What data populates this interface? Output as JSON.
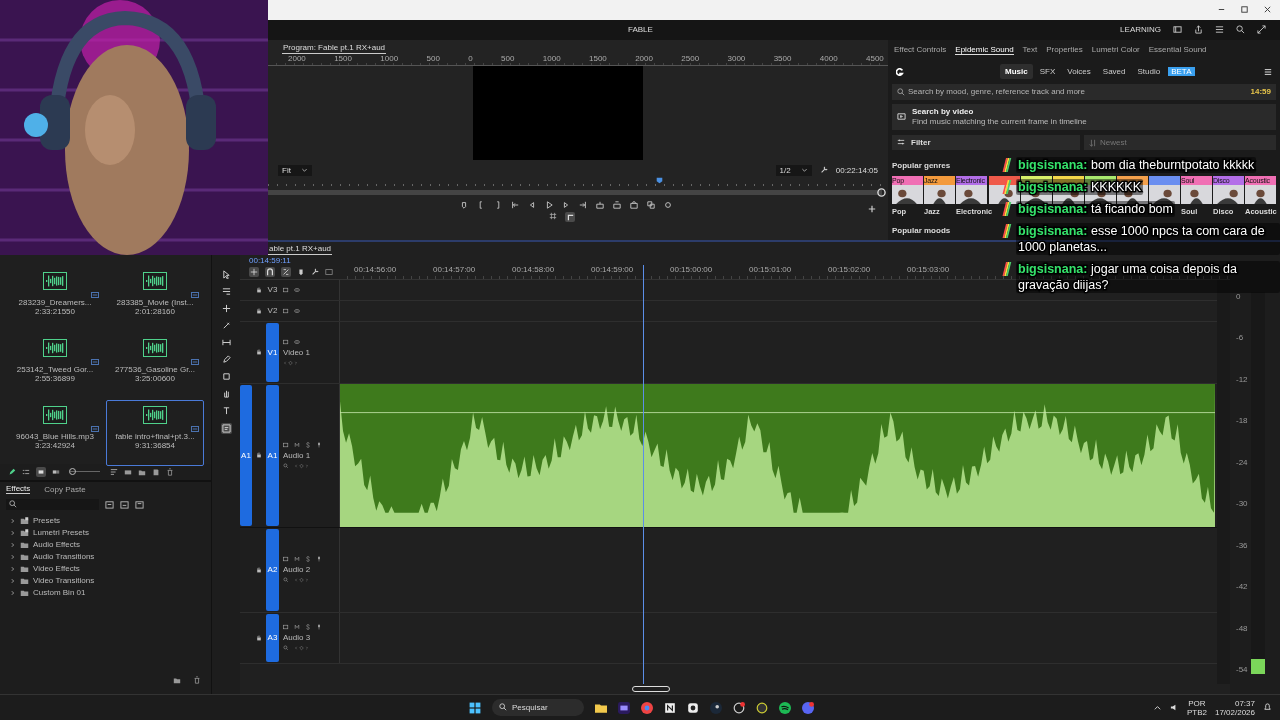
{
  "titlebar": {
    "app_title": "FABLE",
    "workspace": "LEARNING"
  },
  "program_monitor": {
    "tab": "Program: Fable pt.1 RX+aud",
    "ruler": [
      "2000",
      "1500",
      "1000",
      "500",
      "0",
      "500",
      "1000",
      "1500",
      "2000",
      "2500",
      "3000",
      "3500",
      "4000",
      "4500"
    ],
    "zoom": "Fit",
    "resolution": "1/2",
    "timecode": "00:22:14:05",
    "playhead": {
      "level": 0.63
    }
  },
  "panel": {
    "tabs": [
      {
        "label": "Effect Controls",
        "selected": false
      },
      {
        "label": "Epidemic Sound",
        "selected": true
      },
      {
        "label": "Text",
        "selected": false
      },
      {
        "label": "Properties",
        "selected": false
      },
      {
        "label": "Lumetri Color",
        "selected": false
      },
      {
        "label": "Essential Sound",
        "selected": false
      }
    ],
    "nav": [
      {
        "label": "Music",
        "selected": true
      },
      {
        "label": "SFX",
        "selected": false
      },
      {
        "label": "Voices",
        "selected": false
      },
      {
        "label": "Saved",
        "selected": false
      },
      {
        "label": "Studio",
        "selected": false,
        "badge": "BETA"
      }
    ],
    "search": {
      "placeholder": "Search by mood, genre, reference track and more"
    },
    "timer": "14:59",
    "video_search": {
      "title": "Search by video",
      "subtitle": "Find music matching the current frame in timeline"
    },
    "filter": "Filter",
    "sort": {
      "placeholder": "Newest"
    },
    "genres_heading": "Popular genres",
    "genres": [
      {
        "tag": "Pop",
        "label": "Pop",
        "color": "#f06fb4"
      },
      {
        "tag": "Jazz",
        "label": "Jazz",
        "color": "#f39a3c"
      },
      {
        "tag": "Electronic",
        "label": "Electronic",
        "color": "#b36ee8"
      },
      {
        "color": "#ef5a4a"
      },
      {
        "color": "#d8f06a"
      },
      {
        "color": "#f3d64a"
      },
      {
        "color": "#a8e86e"
      },
      {
        "color": "#f3a04c"
      },
      {
        "color": "#6a8ef0"
      },
      {
        "tag": "Soul",
        "label": "Soul",
        "color": "#f06fb4"
      },
      {
        "tag": "Disco",
        "label": "Disco",
        "color": "#b36ee8"
      },
      {
        "tag": "Acoustic",
        "label": "Acoustic",
        "color": "#f06fb4"
      }
    ],
    "moods_heading": "Popular moods"
  },
  "project": {
    "items": [
      {
        "name": "283239_Dreamers...",
        "duration": "2:33:21550",
        "selected": false
      },
      {
        "name": "283385_Movie (Inst...",
        "duration": "2:01:28160",
        "selected": false
      },
      {
        "name": "253142_Tweed Gor...",
        "duration": "2:55:36899",
        "selected": false
      },
      {
        "name": "277536_Gasoline Gr...",
        "duration": "3:25:00600",
        "selected": false
      },
      {
        "name": "96043_Blue Hills.mp3",
        "duration": "3:23:42924",
        "selected": false
      },
      {
        "name": "fable intro+final+pt.3...",
        "duration": "9:31:36854",
        "selected": true
      }
    ],
    "zoom": {
      "level": 0.05
    }
  },
  "effects": {
    "tabs": [
      {
        "label": "Effects",
        "selected": true
      },
      {
        "label": "Copy Paste",
        "selected": false
      }
    ],
    "tree": [
      {
        "label": "Presets",
        "kind": "preset",
        "expanded": false
      },
      {
        "label": "Lumetri Presets",
        "kind": "preset",
        "expanded": false
      },
      {
        "label": "Audio Effects",
        "kind": "folder",
        "expanded": false
      },
      {
        "label": "Audio Transitions",
        "kind": "folder",
        "expanded": false
      },
      {
        "label": "Video Effects",
        "kind": "folder",
        "expanded": false
      },
      {
        "label": "Video Transitions",
        "kind": "folder",
        "expanded": false
      },
      {
        "label": "Custom Bin 01",
        "kind": "folder",
        "expanded": false
      }
    ]
  },
  "timeline": {
    "tab": "able pt.1 RX+aud",
    "timecode": "00:14:59:11",
    "ruler": [
      "00:14:56:00",
      "00:14:57:00",
      "00:14:58:00",
      "00:14:59:00",
      "00:15:00:00",
      "00:15:01:00",
      "00:15:02:00",
      "00:15:03:00"
    ],
    "tracks": [
      {
        "kind": "video",
        "label": "V3",
        "targeted": false
      },
      {
        "kind": "video",
        "label": "V2",
        "targeted": false
      },
      {
        "kind": "video",
        "label": "V1",
        "name": "Video 1",
        "targeted": true
      },
      {
        "kind": "audio",
        "label": "A1",
        "source": "A1",
        "name": "Audio 1",
        "targeted": true,
        "clip": {
          "kind": "audio"
        }
      },
      {
        "kind": "audio",
        "label": "A2",
        "name": "Audio 2",
        "targeted": true
      },
      {
        "kind": "audio",
        "label": "A3",
        "name": "Audio 3",
        "targeted": true
      }
    ]
  },
  "meter": {
    "scale": [
      "0",
      "-6",
      "-12",
      "-18",
      "-24",
      "-30",
      "-36",
      "-42",
      "-48",
      "-54"
    ]
  },
  "chat": [
    {
      "user": "bigsisnana:",
      "text": "bom dia theburntpotato kkkkk"
    },
    {
      "user": "bigsisnana:",
      "text": "KKKKKK"
    },
    {
      "user": "bigsisnana:",
      "text": "tá ficando bom"
    },
    {
      "user": "bigsisnana:",
      "text": "esse 1000 npcs ta com cara de 1000 planetas..."
    },
    {
      "user": "bigsisnana:",
      "text": "jogar uma coisa depois da gravação diijas?"
    }
  ],
  "taskbar": {
    "search": {
      "placeholder": "Pesquisar"
    },
    "language": "POR",
    "layout": "PTB2",
    "time": "07:37",
    "date": "17/02/2026"
  }
}
